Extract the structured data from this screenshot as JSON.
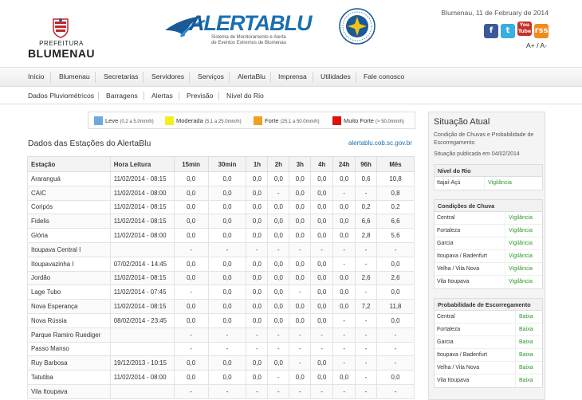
{
  "header": {
    "pref_small": "PREFEITURA",
    "pref_big": "BLUMENAU",
    "alerta_name_a": "A",
    "alerta_name": "LERTABLU",
    "alerta_sub1": "Sistema de Monitoramento e Alerta",
    "alerta_sub2": "de Eventos Extremos de Blumenau",
    "date": "Blumenau, 11 de February de 2014",
    "social": [
      {
        "label": "f",
        "color": "#3b5998"
      },
      {
        "label": "t",
        "color": "#3aaee0"
      },
      {
        "label": "You Tube",
        "color": "#c4302b"
      },
      {
        "label": "rss",
        "color": "#f28a1c"
      }
    ],
    "font_plus": "A+",
    "font_sep": "/",
    "font_minus": "A-"
  },
  "nav": [
    "Início",
    "Blumenau",
    "Secretarias",
    "Servidores",
    "Serviços",
    "AlertaBlu",
    "Imprensa",
    "Utilidades",
    "Fale conosco"
  ],
  "subnav": [
    "Dados Pluviométricos",
    "Barragens",
    "Alertas",
    "Previsão",
    "Nível do Rio"
  ],
  "legend": [
    {
      "label": "Leve",
      "range": "(0,2 a 5.0mm/h)",
      "color": "#6fa8dc"
    },
    {
      "label": "Moderada",
      "range": "(5,1 a 25.0mm/h)",
      "color": "#f0f020"
    },
    {
      "label": "Forte",
      "range": "(25,1 a 50.0mm/h)",
      "color": "#f0a020"
    },
    {
      "label": "Muito Forte",
      "range": "(> 50,0mm/h)",
      "color": "#e01010"
    }
  ],
  "stations": {
    "title": "Dados das Estações do AlertaBlu",
    "link": "alertablu.cob.sc.gov.br",
    "headers": [
      "Estação",
      "Hora Leitura",
      "15min",
      "30min",
      "1h",
      "2h",
      "3h",
      "4h",
      "24h",
      "96h",
      "Mês"
    ],
    "rows": [
      [
        "Araranguá",
        "11/02/2014 - 08:15",
        "0,0",
        "0,0",
        "0,0",
        "0,0",
        "0,0",
        "0,0",
        "0,0",
        "0,6",
        "10,8"
      ],
      [
        "CAIC",
        "11/02/2014 - 08:00",
        "0,0",
        "0,0",
        "0,0",
        "-",
        "0,0",
        "0,0",
        "-",
        "-",
        "0,8"
      ],
      [
        "Coripós",
        "11/02/2014 - 08:15",
        "0,0",
        "0,0",
        "0,0",
        "0,0",
        "0,0",
        "0,0",
        "0,0",
        "0,2",
        "0,2"
      ],
      [
        "Fidelis",
        "11/02/2014 - 08:15",
        "0,0",
        "0,0",
        "0,0",
        "0,0",
        "0,0",
        "0,0",
        "0,0",
        "6,6",
        "6,6"
      ],
      [
        "Glória",
        "11/02/2014 - 08:00",
        "0,0",
        "0,0",
        "0,0",
        "0,0",
        "0,0",
        "0,0",
        "0,0",
        "2,8",
        "5,6"
      ],
      [
        "Itoupava Central I",
        "",
        "-",
        "-",
        "-",
        "-",
        "-",
        "-",
        "-",
        "-",
        "-"
      ],
      [
        "Itoupavazinha I",
        "07/02/2014 - 14:45",
        "0,0",
        "0,0",
        "0,0",
        "0,0",
        "0,0",
        "0,0",
        "-",
        "-",
        "0,0"
      ],
      [
        "Jordão",
        "11/02/2014 - 08:15",
        "0,0",
        "0,0",
        "0,0",
        "0,0",
        "0,0",
        "0,0",
        "0,0",
        "2,6",
        "2,6"
      ],
      [
        "Lage Tubo",
        "11/02/2014 - 07:45",
        "-",
        "0,0",
        "0,0",
        "0,0",
        "-",
        "0,0",
        "0,0",
        "-",
        "0,0"
      ],
      [
        "Nova Esperança",
        "11/02/2014 - 08:15",
        "0,0",
        "0,0",
        "0,0",
        "0,0",
        "0,0",
        "0,0",
        "0,0",
        "7,2",
        "11,8"
      ],
      [
        "Nova Rússia",
        "08/02/2014 - 23:45",
        "0,0",
        "0,0",
        "0,0",
        "0,0",
        "0,0",
        "0,0",
        "-",
        "-",
        "0,0"
      ],
      [
        "Parque Ramiro Ruediger",
        "",
        "-",
        "-",
        "-",
        "-",
        "-",
        "-",
        "-",
        "-",
        "-"
      ],
      [
        "Passo Manso",
        "",
        "-",
        "-",
        "-",
        "-",
        "-",
        "-",
        "-",
        "-",
        "-"
      ],
      [
        "Ruy Barbosa",
        "19/12/2013 - 10:15",
        "0,0",
        "0,0",
        "0,0",
        "0,0",
        "-",
        "0,0",
        "-",
        "-",
        "-"
      ],
      [
        "Tatutiba",
        "11/02/2014 - 08:00",
        "0,0",
        "0,0",
        "0,0",
        "-",
        "0,0",
        "0,0",
        "0,0",
        "-",
        "0,0"
      ],
      [
        "Vila Itoupava",
        "",
        "-",
        "-",
        "-",
        "-",
        "-",
        "-",
        "-",
        "-",
        "-"
      ]
    ]
  },
  "sidebar": {
    "title": "Situação Atual",
    "subtitle": "Condição de Chuvas e Probabilidade de Escorregamento",
    "published": "Situação publicada em 04/02/2014",
    "rio": {
      "title": "Nível do Rio",
      "rows": [
        [
          "Itajaí-Açú",
          "Vigilância"
        ]
      ]
    },
    "chuva": {
      "title": "Condições de Chuva",
      "rows": [
        [
          "Central",
          "Vigilância"
        ],
        [
          "Fortaleza",
          "Vigilância"
        ],
        [
          "Garcia",
          "Vigilância"
        ],
        [
          "Itoupava / Badenfurt",
          "Vigilância"
        ],
        [
          "Velha / Vila Nova",
          "Vigilância"
        ],
        [
          "Vila Itoupava",
          "Vigilância"
        ]
      ]
    },
    "escorregamento": {
      "title": "Probabilidade de Escorregamento",
      "rows": [
        [
          "Central",
          "Baixa"
        ],
        [
          "Fortaleza",
          "Baixa"
        ],
        [
          "Garcia",
          "Baixa"
        ],
        [
          "Itoupava / Badenfurt",
          "Baixa"
        ],
        [
          "Velha / Vila Nova",
          "Baixa"
        ],
        [
          "Vila Itoupava",
          "Baixa"
        ]
      ]
    }
  }
}
